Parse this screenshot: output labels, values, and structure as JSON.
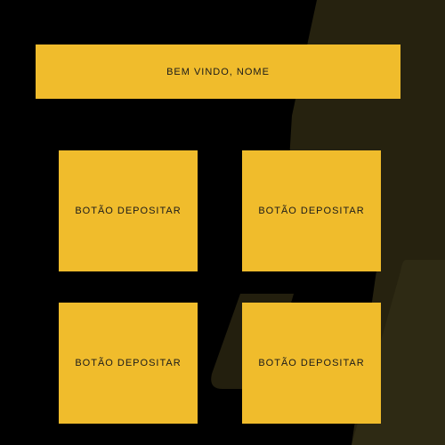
{
  "banner": {
    "text": "BEM VINDO, NOME"
  },
  "tiles": [
    {
      "label": "BOTÃO DEPOSITAR"
    },
    {
      "label": "BOTÃO DEPOSITAR"
    },
    {
      "label": "BOTÃO DEPOSITAR"
    },
    {
      "label": "BOTÃO DEPOSITAR"
    }
  ],
  "colors": {
    "background": "#000000",
    "accent": "#f0bc2c",
    "shape": "#2a2410",
    "text": "#1a1a1a"
  }
}
